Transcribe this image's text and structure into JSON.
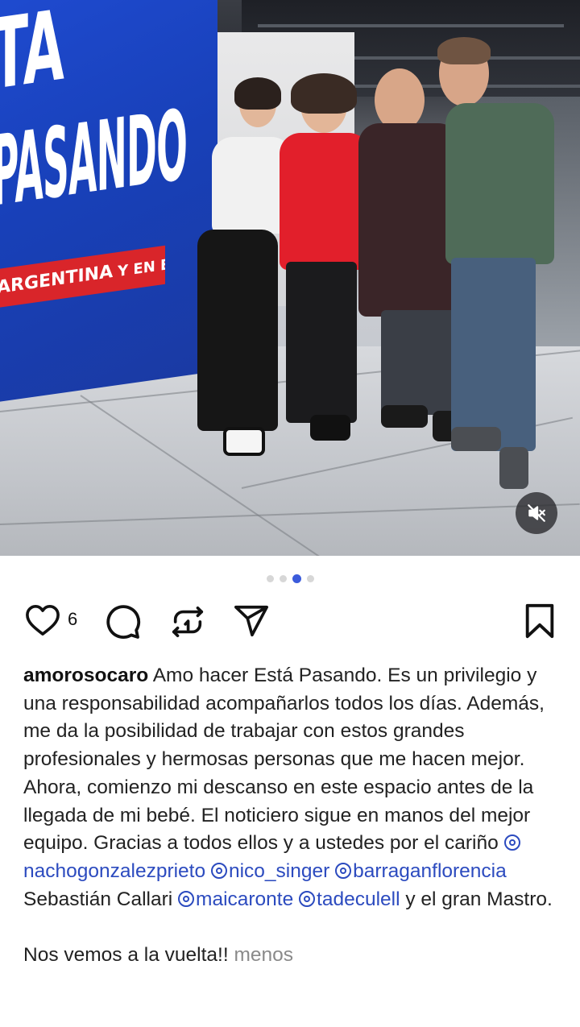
{
  "photo": {
    "panel_line1": "TA",
    "panel_line2": "PASANDO",
    "panel_strip_main": "ARGENTINA",
    "panel_strip_small": "Y EN EL MUNDO",
    "mute_icon": "volume-off-icon"
  },
  "carousel": {
    "total": 4,
    "active_index": 2
  },
  "actions": {
    "like_icon": "heart-icon",
    "like_count": "6",
    "comment_icon": "comment-icon",
    "repost_icon": "repost-icon",
    "share_icon": "send-icon",
    "save_icon": "bookmark-icon"
  },
  "caption": {
    "username": "amorosocaro",
    "text_1": "Amo hacer Está Pasando. Es un privilegio y una responsabilidad acompañarlos todos los días. Además, me da la posibilidad de trabajar con estos grandes profesionales y hermosas personas que me hacen mejor.",
    "text_2": "Ahora, comienzo mi descanso en este espacio antes de la llegada de mi bebé. El noticiero sigue en manos del mejor equipo. Gracias a todos ellos y a ustedes por el cariño",
    "mention_1": "nachogonzalezprieto",
    "mention_2": "nico_singer",
    "mention_3": "barraganflorencia",
    "plain_name": "Sebastián Callari",
    "mention_4": "maicaronte",
    "mention_5": "tadeculell",
    "text_3": "y el gran Mastro.",
    "text_4": "Nos vemos a la vuelta!!",
    "less_label": "menos"
  },
  "colors": {
    "mention": "#2c4bbf",
    "dot_active": "#3b5bdb",
    "muted_text": "#8a8a8a"
  }
}
